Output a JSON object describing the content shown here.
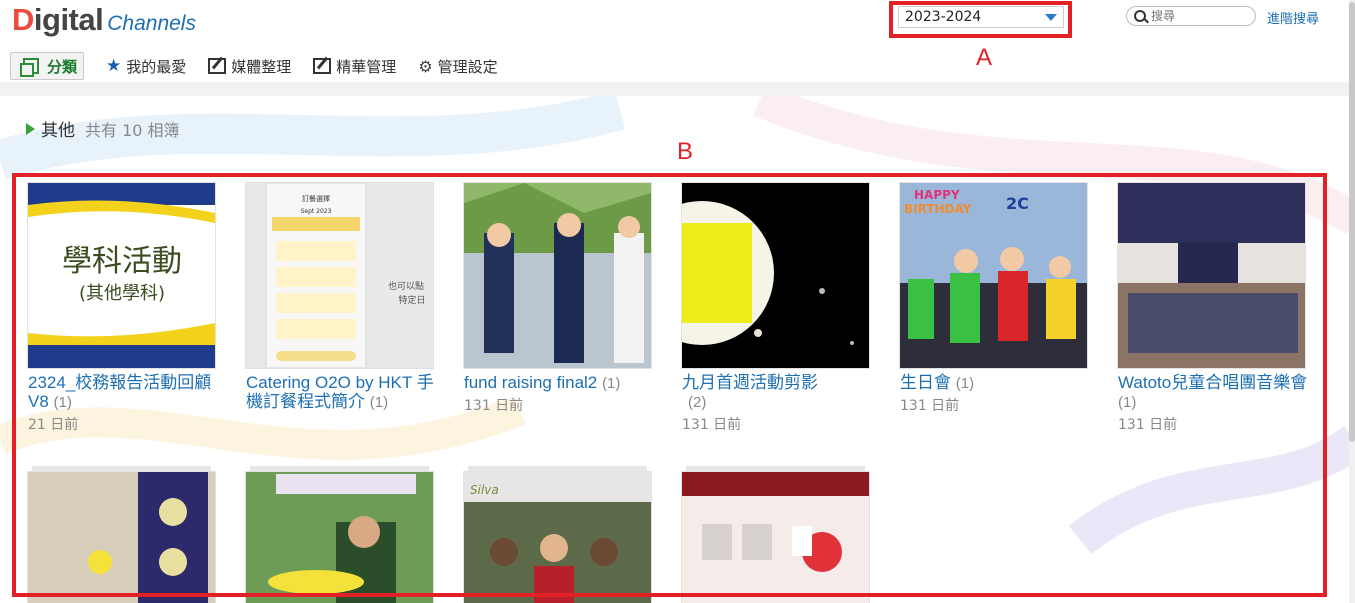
{
  "header": {
    "logo_part1": "Digital",
    "logo_part2": "Channels",
    "year_selected": "2023-2024",
    "search_placeholder": "搜尋",
    "advanced_search": "進階搜尋"
  },
  "nav": [
    {
      "label": "分類",
      "icon": "album-icon"
    },
    {
      "label": "我的最愛",
      "icon": "star-icon"
    },
    {
      "label": "媒體整理",
      "icon": "edit-icon"
    },
    {
      "label": "精華管理",
      "icon": "edit-icon"
    },
    {
      "label": "管理設定",
      "icon": "gear-icon"
    }
  ],
  "annotations": {
    "a": "A",
    "b": "B"
  },
  "category": {
    "name": "其他",
    "count_text": "共有 10 相簿"
  },
  "albums": [
    {
      "title": "2324_校務報告活動回顧V8",
      "count": "(1)",
      "date": "21 日前"
    },
    {
      "title": "Catering O2O by HKT 手機訂餐程式簡介",
      "count": "(1)",
      "date": ""
    },
    {
      "title": "fund raising final2",
      "count": "(1)",
      "date": "131 日前"
    },
    {
      "title": "九月首週活動剪影",
      "count": "(2)",
      "date": "131 日前"
    },
    {
      "title": "生日會",
      "count": "(1)",
      "date": "131 日前"
    },
    {
      "title": "Watoto兒童合唱團音樂會",
      "count": "(1)",
      "date": "131 日前"
    },
    {
      "title": "",
      "count": "",
      "date": ""
    },
    {
      "title": "",
      "count": "",
      "date": ""
    },
    {
      "title": "",
      "count": "",
      "date": ""
    },
    {
      "title": "",
      "count": "",
      "date": ""
    }
  ],
  "thumb_text": {
    "t1_main": "學科活動",
    "t1_sub": "(其他學科)",
    "t2_header": "訂餐選擇",
    "t2_month": "Sept 2023",
    "t2_side": "也可以點\n特定日",
    "t5_banner": "HAPPY BIRTHDAY",
    "t5_class": "2C",
    "t9_label": "Silva"
  },
  "colors": {
    "accent_red": "#e32026",
    "link_blue": "#1d6fb3",
    "nav_green": "#2e8b3a"
  }
}
